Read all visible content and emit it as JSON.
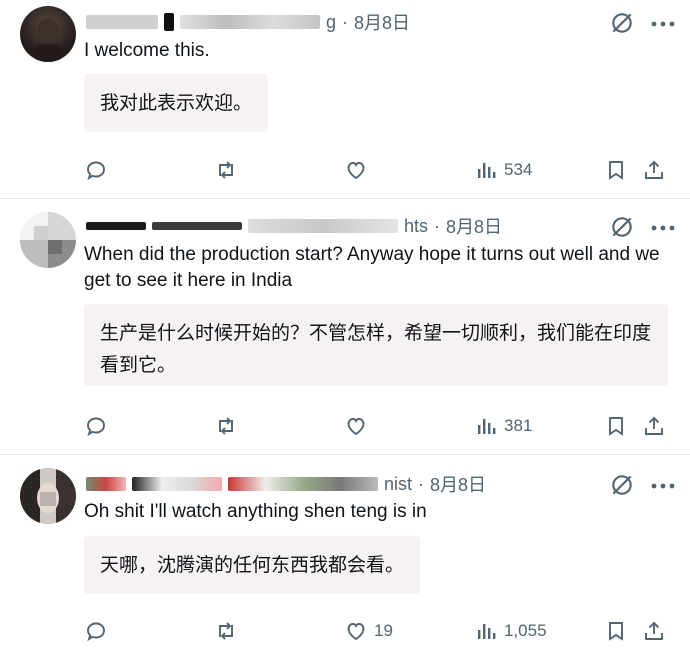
{
  "tweets": [
    {
      "date": "8月8日",
      "handle_fragment": "g",
      "text": "I welcome this.",
      "translation": "我对此表示欢迎。",
      "actions": {
        "views": "534",
        "likes": "",
        "retweets": "",
        "replies": ""
      }
    },
    {
      "date": "8月8日",
      "handle_fragment": "hts",
      "text": "When did the production start? Anyway hope it turns out well and we get to see it here in India",
      "translation": "生产是什么时候开始的？不管怎样，希望一切顺利，我们能在印度看到它。",
      "actions": {
        "views": "381",
        "likes": "",
        "retweets": "",
        "replies": ""
      }
    },
    {
      "date": "8月8日",
      "handle_fragment": "nist",
      "text": "Oh shit I'll watch anything shen teng is in",
      "translation": "天哪，沈腾演的任何东西我都会看。",
      "actions": {
        "views": "1,055",
        "likes": "19",
        "retweets": "",
        "replies": ""
      }
    }
  ],
  "meta_separator": "·",
  "icons": [
    "reply-icon",
    "retweet-icon",
    "like-icon",
    "views-icon",
    "bookmark-icon",
    "share-icon",
    "grok-icon",
    "more-icon"
  ],
  "colors": {
    "text": "#0f1419",
    "muted": "#536471",
    "translation_bg": "#f7f2f2",
    "divider": "#e6e6e6"
  }
}
